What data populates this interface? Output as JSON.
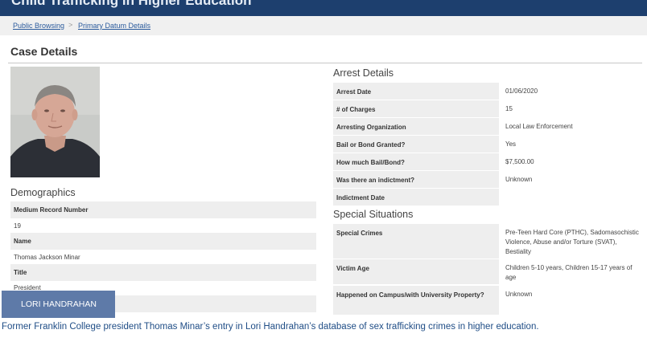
{
  "header": {
    "site_title": "Child Trafficking in Higher Education"
  },
  "breadcrumb": {
    "items": [
      "Public Browsing",
      "Primary Datum Details"
    ],
    "separator": ">"
  },
  "page_title": "Case Details",
  "demographics": {
    "heading": "Demographics",
    "fields": [
      {
        "label": "Medium Record Number",
        "value": "19"
      },
      {
        "label": "Name",
        "value": "Thomas Jackson Minar"
      },
      {
        "label": "Title",
        "value": "President"
      }
    ]
  },
  "arrest_details": {
    "heading": "Arrest Details",
    "fields": [
      {
        "label": "Arrest Date",
        "value": "01/06/2020"
      },
      {
        "label": "# of Charges",
        "value": "15"
      },
      {
        "label": "Arresting Organization",
        "value": "Local Law Enforcement"
      },
      {
        "label": "Bail or Bond Granted?",
        "value": "Yes"
      },
      {
        "label": "How much Bail/Bond?",
        "value": "$7,500.00"
      },
      {
        "label": "Was there an indictment?",
        "value": "Unknown"
      },
      {
        "label": "Indictment Date",
        "value": ""
      }
    ]
  },
  "special_situations": {
    "heading": "Special Situations",
    "fields": [
      {
        "label": "Special Crimes",
        "value": "Pre-Teen Hard Core (PTHC), Sadomasochistic Violence, Abuse and/or Torture (SVAT), Bestiality"
      },
      {
        "label": "Victim Age",
        "value": "Children 5-10 years, Children 15-17 years of age"
      },
      {
        "label": "Happened on Campus/with University Property?",
        "value": "Unknown"
      }
    ]
  },
  "photo": {
    "alt": "booking photo"
  },
  "credit_badge": "LORI HANDRAHAN",
  "caption": "Former Franklin College president Thomas Minar’s entry in Lori Handrahan’s database of sex trafficking crimes in higher education.",
  "colors": {
    "header_bg": "#1d3f6e",
    "link": "#2a5a9c",
    "label_bg": "#eeeeee",
    "badge_bg": "#5e7aa8",
    "caption": "#1f4d86"
  }
}
